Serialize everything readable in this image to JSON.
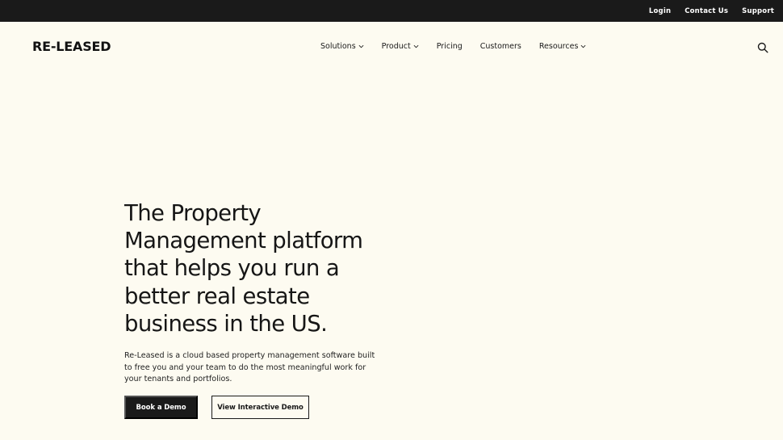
{
  "topbar": {
    "links": [
      "Login",
      "Contact Us",
      "Support"
    ]
  },
  "header": {
    "logo": "RE-­LEASED",
    "nav": [
      {
        "label": "Solutions",
        "dropdown": true
      },
      {
        "label": "Product",
        "dropdown": true
      },
      {
        "label": "Pricing",
        "dropdown": false
      },
      {
        "label": "Customers",
        "dropdown": false
      },
      {
        "label": "Resources",
        "dropdown": true
      }
    ],
    "search_icon": "search-icon"
  },
  "hero": {
    "headline_lines": [
      "The Property",
      "Management platform",
      "that helps you run a",
      "better real estate",
      "business in the US."
    ],
    "subtext": "Re-Leased is a cloud based property management software built to free you and your team to do the most meaningful work for your tenants and portfolios.",
    "primary_cta": "Book a Demo",
    "secondary_cta": "View Interactive Demo"
  },
  "colors": {
    "background": "#fdfbf1",
    "topbar": "#1a1a1a",
    "text": "#1a1a1a",
    "button_primary": "#1a1a1a"
  }
}
